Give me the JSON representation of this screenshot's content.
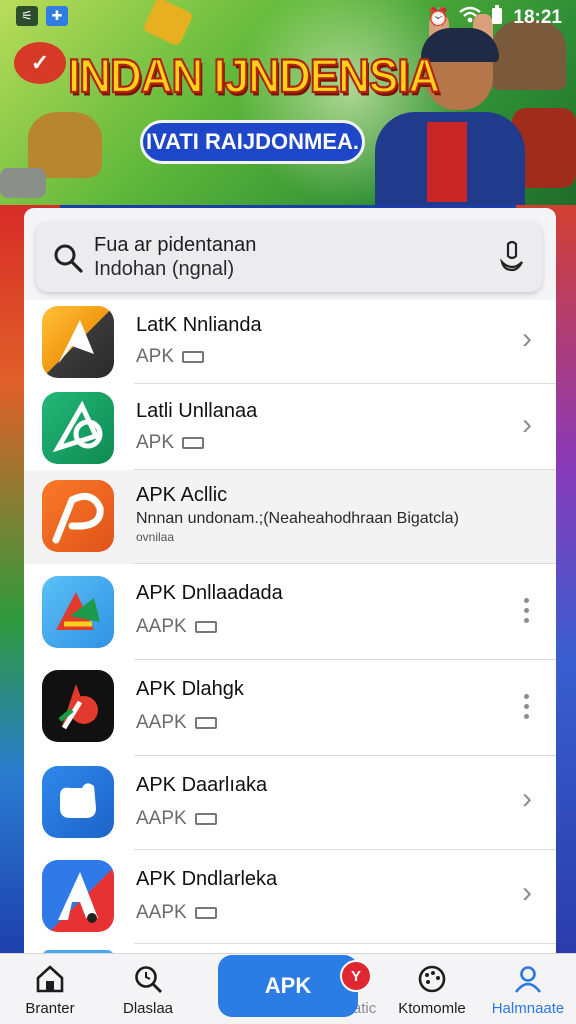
{
  "status_bar": {
    "time": "18:21"
  },
  "banner": {
    "title": "INDAN IJNDENSIA",
    "pill": "IVATI RAIJDONMEA."
  },
  "search": {
    "line1": "Fua ar pidentanan",
    "line2": "Indohan (ngnal)"
  },
  "apps": [
    {
      "name": "LatK Nnlianda",
      "sub": "APK",
      "trailing": "chevron",
      "colors": [
        "#ffb020",
        "#3a3a3a"
      ]
    },
    {
      "name": "Latli Unllanaa",
      "sub": "APK",
      "trailing": "chevron",
      "colors": [
        "#1aa36a",
        "#0f7a4a"
      ]
    },
    {
      "name": "APK Acllic",
      "desc": "Nnnan undonam.;(Neaheahodhraan Bigatcla)",
      "desc2": "ovnilaa",
      "trailing": "none",
      "colors": [
        "#f4661e",
        "#d84a14"
      ]
    },
    {
      "name": "APK Dnllaadada",
      "sub": "AAPK",
      "trailing": "dots",
      "colors": [
        "#4cb0f2",
        "#2a8ee0"
      ]
    },
    {
      "name": "APK Dlahgk",
      "sub": "AAPK",
      "trailing": "dots",
      "colors": [
        "#111111",
        "#222222"
      ]
    },
    {
      "name": "APK Daarlıaka",
      "sub": "AAPK",
      "trailing": "chevron",
      "colors": [
        "#2b78e4",
        "#1f5fc4"
      ]
    },
    {
      "name": "APK Dndlarleka",
      "sub": "AAPK",
      "trailing": "chevron",
      "colors": [
        "#2b6ee0",
        "#e03030"
      ]
    }
  ],
  "bottom_nav": {
    "items": [
      {
        "label": "Branter",
        "icon": "home-icon"
      },
      {
        "label": "Dlaslaa",
        "icon": "search-icon"
      },
      {
        "label": "Plasatic",
        "icon": "apk-icon"
      },
      {
        "label": "Ktomomle",
        "icon": "palette-icon"
      },
      {
        "label": "Halmnaate",
        "icon": "profile-icon"
      }
    ],
    "apk_button": "APK",
    "badge": "Y"
  },
  "colors": {
    "accent": "#2b7de3",
    "badge": "#e0262f"
  }
}
